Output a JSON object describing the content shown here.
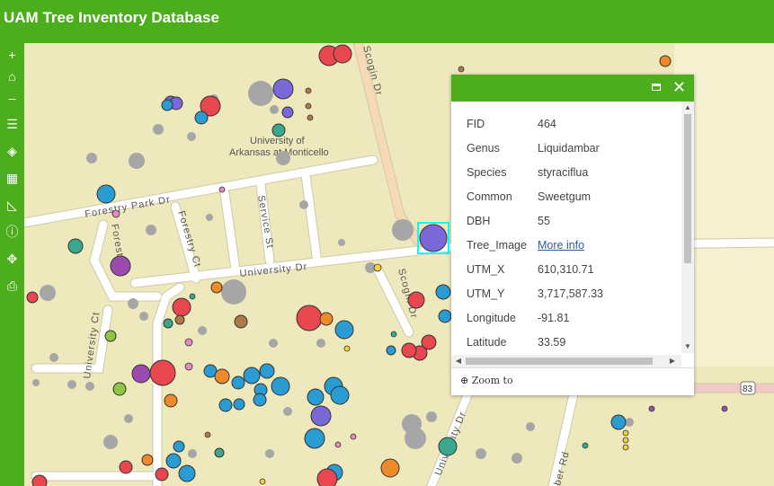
{
  "app": {
    "title": "UAM Tree Inventory Database"
  },
  "toolbar": {
    "zoom_in": "+",
    "home": "⌂",
    "zoom_out": "–",
    "legend": "☰",
    "layers": "◈",
    "basemap": "▦",
    "measure": "◺",
    "about": "ⓘ",
    "directions": "✥",
    "print": "⎙"
  },
  "map": {
    "streets": {
      "forestry_park": "Forestry Park Dr",
      "forestry_ct": "Forestry Ct",
      "forest_pl": "Forest Pl",
      "service": "Service St",
      "university_dr": "University Dr",
      "university_ct": "University Ct",
      "scogin_top": "Scogin Dr",
      "scogin_low": "Scogin Dr",
      "university_dr_lower": "University Dr",
      "ber_rd": "ber Rd"
    },
    "campus_label_1": "University of",
    "campus_label_2": "Arkansas at Monticello",
    "route_shield": "83",
    "colors": {
      "land": "#eee8bd",
      "road": "#ffffff",
      "grey_tree": "#a6a6a6",
      "highlight": "#00ffff"
    }
  },
  "popup": {
    "fields": [
      {
        "key": "FID",
        "value": "464"
      },
      {
        "key": "Genus",
        "value": "Liquidambar"
      },
      {
        "key": "Species",
        "value": "styraciflua"
      },
      {
        "key": "Common",
        "value": "Sweetgum"
      },
      {
        "key": "DBH",
        "value": "55"
      },
      {
        "key": "Tree_Image",
        "value": "More info"
      },
      {
        "key": "UTM_X",
        "value": "610,310.71"
      },
      {
        "key": "UTM_Y",
        "value": "3,717,587.33"
      },
      {
        "key": "Longitude",
        "value": "-91.81"
      },
      {
        "key": "Latitude",
        "value": "33.59"
      }
    ],
    "zoom_to": "Zoom to",
    "zoom_icon": "magnifier-icon",
    "close": "✕"
  }
}
